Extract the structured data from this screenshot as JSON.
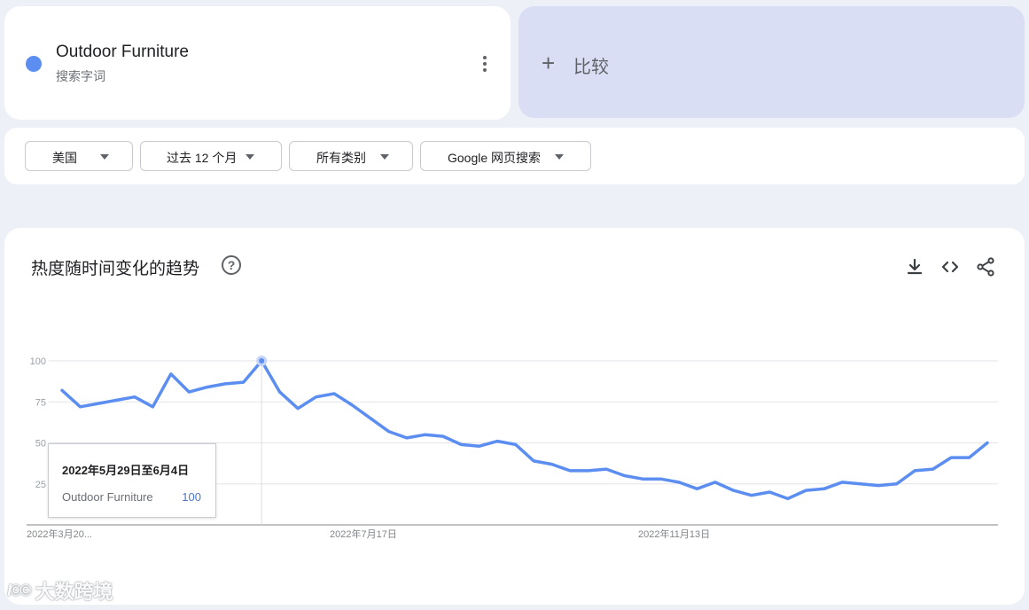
{
  "term": {
    "name": "Outdoor Furniture",
    "type": "搜索字词",
    "color": "#5b8ef0"
  },
  "compare": {
    "label": "比较"
  },
  "filters": {
    "region": "美国",
    "time": "过去 12 个月",
    "category": "所有类别",
    "search_type": "Google 网页搜索"
  },
  "chart": {
    "title": "热度随时间变化的趋势",
    "tooltip": {
      "date": "2022年5月29日至6月4日",
      "term": "Outdoor Furniture",
      "value": "100"
    }
  },
  "watermark": {
    "logo": "I©©",
    "text": "大数跨境"
  },
  "chart_data": {
    "type": "line",
    "title": "热度随时间变化的趋势",
    "xlabel": "",
    "ylabel": "",
    "ylim": [
      0,
      100
    ],
    "y_ticks": [
      "25",
      "50",
      "75",
      "100"
    ],
    "x_tick_labels": [
      "2022年3月20...",
      "2022年7月17日",
      "2022年11月13日"
    ],
    "grid": true,
    "series": [
      {
        "name": "Outdoor Furniture",
        "color": "#5b8ef0",
        "values": [
          82,
          72,
          74,
          76,
          78,
          72,
          92,
          81,
          84,
          86,
          87,
          100,
          81,
          71,
          78,
          80,
          73,
          65,
          57,
          53,
          55,
          54,
          49,
          48,
          51,
          49,
          39,
          37,
          33,
          33,
          34,
          30,
          28,
          28,
          26,
          22,
          26,
          21,
          18,
          20,
          16,
          21,
          22,
          26,
          25,
          24,
          25,
          33,
          34,
          41,
          41,
          50
        ]
      }
    ]
  }
}
